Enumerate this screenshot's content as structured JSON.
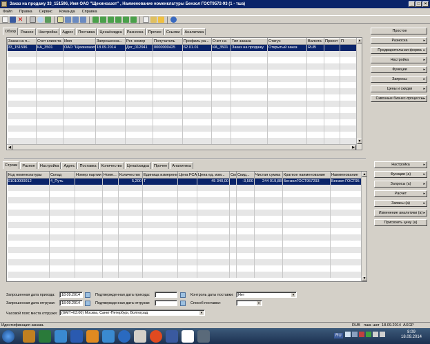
{
  "window": {
    "title": "Заказ на продажу 33_151596, Имя ОАО \"Щекиноазот\" , Наименование номенклатуры Бензол ГОСТ9572-93 (1 - тша)"
  },
  "menu": [
    "Файл",
    "Правка",
    "Сервис",
    "Команда",
    "Справка"
  ],
  "top_tabs": [
    "Обзор",
    "Разное",
    "Настройка",
    "Адрес",
    "Поставка",
    "Цена/скидка",
    "Разноска",
    "Прочее",
    "Ссылки",
    "Аналитика"
  ],
  "top_grid": {
    "columns": [
      "Заказ на п...",
      "Счет клиента",
      "Имя",
      "Запрошенна...",
      "Рег. номер",
      "Получатель",
      "Профиль ра...",
      "Счет на",
      "Тип заказа",
      "Статус",
      "Валюта",
      "Проект",
      "П"
    ],
    "rows": [
      [
        "33_151596",
        "КА_3501",
        "ОАО \"Щекиноазот\"",
        "18.09.2014",
        "Дог_012941",
        "0000000425",
        "62.01.01",
        "КА_3501",
        "Заказ на продажу",
        "Открытый заказ",
        "RUB",
        "",
        ""
      ]
    ]
  },
  "right_top_buttons": [
    {
      "label": "Простое",
      "arrow": ""
    },
    {
      "label": "Разноска",
      "arrow": "▸"
    },
    {
      "label": "Предварительная форма",
      "arrow": "▸"
    },
    {
      "label": "Настройка",
      "arrow": "▸"
    },
    {
      "label": "Функции",
      "arrow": "▸"
    },
    {
      "label": "Запросы",
      "arrow": "▸"
    },
    {
      "label": "Цены и скидки",
      "arrow": "▸"
    },
    {
      "label": "Сквозные бизнес-процессы",
      "arrow": "▸"
    }
  ],
  "bottom_tabs": [
    "Строки",
    "Разное",
    "Настройка",
    "Адрес",
    "Поставка",
    "Количество",
    "Цена/скидка",
    "Прочее",
    "Аналитика"
  ],
  "bottom_grid": {
    "columns": [
      "Код номенклатуры",
      "Склад",
      "Номер партии",
      "Номе...",
      "Количество",
      "Единица измерения",
      "Цена FCA",
      "Цена ед. изм...",
      "Склад",
      "Скид...",
      "Чистая сумма",
      "Краткое наименование",
      "Наименование"
    ],
    "rows": [
      [
        "01010000012",
        "4_Путь",
        "",
        "",
        "5,200",
        "Т",
        "",
        "45 340,00",
        "",
        "-3,500",
        "244 019,88",
        "БензолГОСТ957293",
        "Бензол ГОСТ95"
      ]
    ]
  },
  "right_bottom_buttons": [
    {
      "label": "Настройка",
      "arrow": "▸"
    },
    {
      "label": "Функции (а)",
      "arrow": "▸"
    },
    {
      "label": "Запросы (а)",
      "arrow": "▸"
    },
    {
      "label": "Расчет",
      "arrow": "▸"
    },
    {
      "label": "Запасы (а)",
      "arrow": "▸"
    },
    {
      "label": "Изменение аналитики (а)",
      "arrow": "▸"
    },
    {
      "label": "Присвоить цену (а)",
      "arrow": ""
    }
  ],
  "form": {
    "req_receipt_label": "Запрошенная дата прихода:",
    "req_receipt_value": "18.09.2014",
    "conf_receipt_label": "Подтвержденная дата прихода:",
    "conf_receipt_value": "",
    "delivery_ctrl_label": "Контроль даты поставки:",
    "delivery_ctrl_value": "Нет",
    "req_ship_label": "Запрошенная дата отгрузки:",
    "req_ship_value": "18.09.2014",
    "conf_ship_label": "Подтвержденная дата отгрузки:",
    "conf_ship_value": "",
    "delivery_method_label": "Способ поставки:",
    "delivery_method_value": "",
    "timezone_label": "Часовой пояс места отгрузки:",
    "timezone_value": "(GMT+03:00) Москва, Санкт-Петербург, Волгоград"
  },
  "status": {
    "text": "Идентификация заказа.",
    "currency": "RUB",
    "user": "пша",
    "company": "шег",
    "date": "18.09.2014",
    "app": "AXGP"
  },
  "taskbar": {
    "lang": "RU",
    "time": "8:09",
    "date": "18.09.2014"
  },
  "colors": {
    "title": "#0a246a",
    "selection": "#0a246a",
    "face": "#d4d0c8"
  }
}
